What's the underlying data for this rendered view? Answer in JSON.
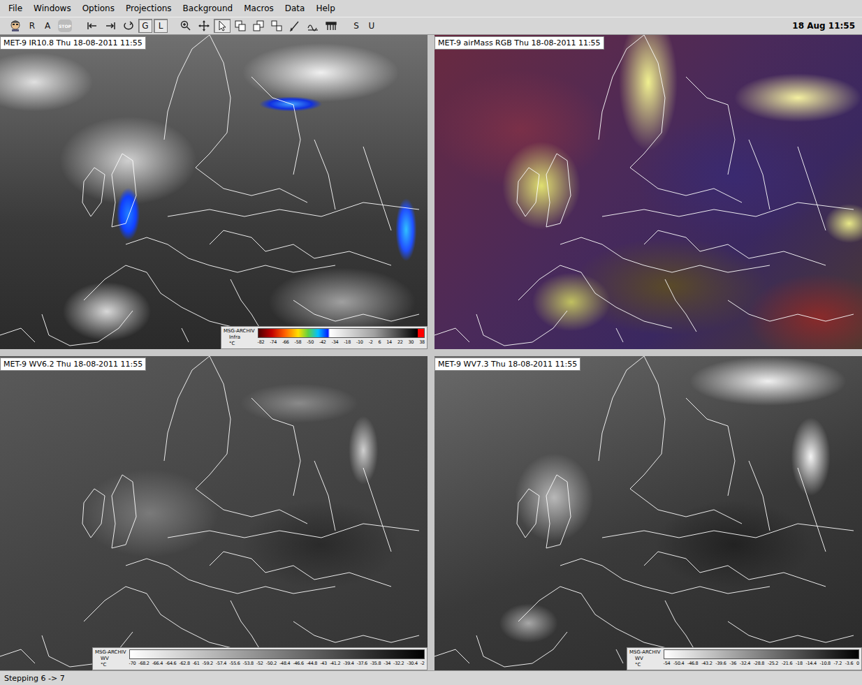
{
  "menu": [
    {
      "label": "File"
    },
    {
      "label": "Windows"
    },
    {
      "label": "Options"
    },
    {
      "label": "Projections"
    },
    {
      "label": "Background"
    },
    {
      "label": "Macros"
    },
    {
      "label": "Data"
    },
    {
      "label": "Help"
    }
  ],
  "toolbar": {
    "items": [
      {
        "kind": "icon",
        "selected": false
      },
      {
        "kind": "text",
        "label": "R",
        "selected": false
      },
      {
        "kind": "text",
        "label": "A",
        "selected": false
      },
      {
        "kind": "stop",
        "label": "STOP",
        "selected": false
      },
      {
        "kind": "separator"
      },
      {
        "kind": "icon",
        "selected": false
      },
      {
        "kind": "icon",
        "selected": false
      },
      {
        "kind": "icon",
        "selected": false
      },
      {
        "kind": "text",
        "label": "G",
        "selected": true
      },
      {
        "kind": "text",
        "label": "L",
        "selected": true
      },
      {
        "kind": "separator"
      },
      {
        "kind": "icon",
        "selected": false
      },
      {
        "kind": "icon",
        "selected": false
      },
      {
        "kind": "icon",
        "selected": true
      },
      {
        "kind": "icon",
        "selected": false
      },
      {
        "kind": "icon",
        "selected": false
      },
      {
        "kind": "icon",
        "selected": false
      },
      {
        "kind": "icon",
        "selected": false
      },
      {
        "kind": "icon",
        "selected": false
      },
      {
        "kind": "icon",
        "selected": false
      },
      {
        "kind": "separator"
      },
      {
        "kind": "text",
        "label": "S",
        "selected": false
      },
      {
        "kind": "text",
        "label": "U",
        "selected": false
      }
    ],
    "clock": "18 Aug 11:55"
  },
  "panels": [
    {
      "title": "MET-9 IR10.8 Thu 18-08-2011 11:55",
      "imagery": "ir",
      "legend": {
        "kind": "ir",
        "source": "MSG-ARCHIV",
        "channel": "Infra",
        "unit": "°C",
        "ticks": [
          "-82",
          "-74",
          "-66",
          "-58",
          "-50",
          "-42",
          "-34",
          "-18",
          "-10",
          "-2",
          "6",
          "14",
          "22",
          "30",
          "38"
        ]
      }
    },
    {
      "title": "MET-9 airMass RGB Thu 18-08-2011 11:55",
      "imagery": "airmass",
      "legend": null
    },
    {
      "title": "MET-9 WV6.2 Thu 18-08-2011 11:55",
      "imagery": "wv62",
      "legend": {
        "kind": "wv",
        "source": "MSG-ARCHIV",
        "channel": "WV",
        "unit": "°C",
        "ticks": [
          "-70",
          "-68.2",
          "-66.4",
          "-64.6",
          "-62.8",
          "-61",
          "-59.2",
          "-57.4",
          "-55.6",
          "-53.8",
          "-52",
          "-50.2",
          "-48.4",
          "-46.6",
          "-44.8",
          "-43",
          "-41.2",
          "-39.4",
          "-37.6",
          "-35.8",
          "-34",
          "-32.2",
          "-30.4",
          "-2"
        ]
      }
    },
    {
      "title": "MET-9 WV7.3 Thu 18-08-2011 11:55",
      "imagery": "wv73",
      "legend": {
        "kind": "wv",
        "source": "MSG-ARCHIV",
        "channel": "WV",
        "unit": "°C",
        "ticks": [
          "-54",
          "-50.4",
          "-46.8",
          "-43.2",
          "-39.6",
          "-36",
          "-32.4",
          "-28.8",
          "-25.2",
          "-21.6",
          "-18",
          "-14.4",
          "-10.8",
          "-7.2",
          "-3.6",
          "0"
        ]
      }
    }
  ],
  "status_bar": "Stepping 6 -> 7"
}
